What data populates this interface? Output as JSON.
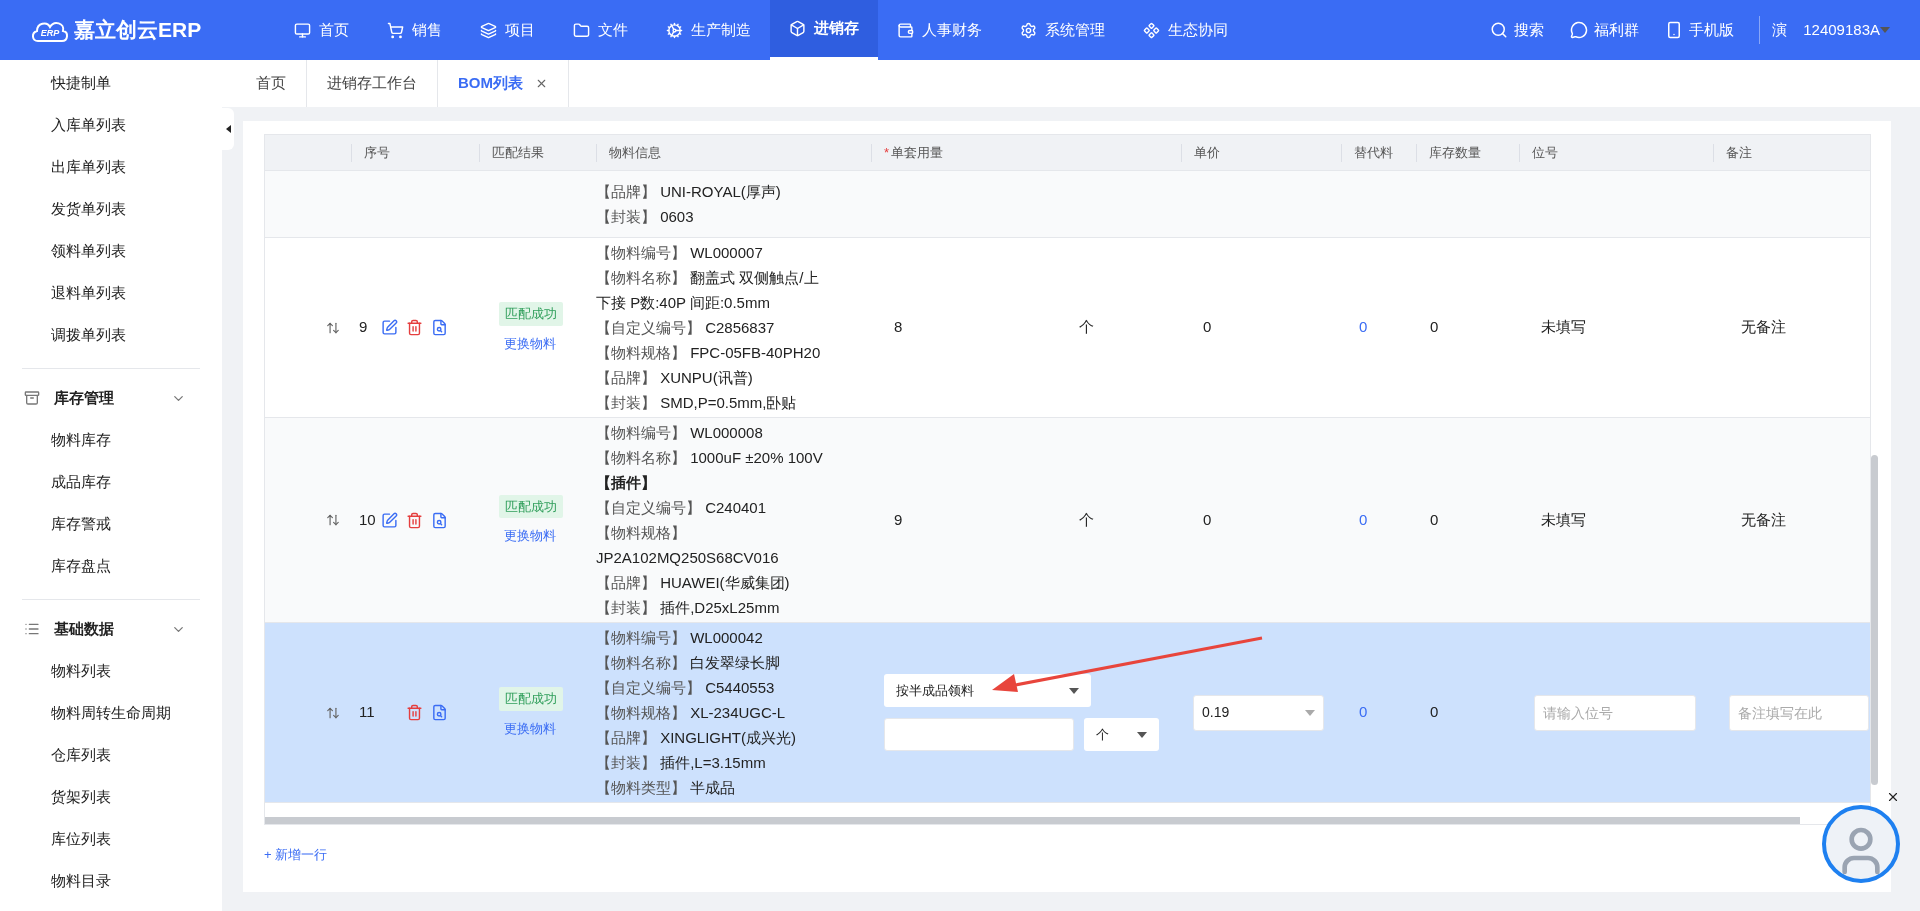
{
  "header": {
    "logo_badge": "ERP",
    "logo_text": "嘉立创云ERP",
    "nav": [
      {
        "label": "首页",
        "selected": false
      },
      {
        "label": "销售",
        "selected": false
      },
      {
        "label": "项目",
        "selected": false
      },
      {
        "label": "文件",
        "selected": false
      },
      {
        "label": "生产制造",
        "selected": false
      },
      {
        "label": "进销存",
        "selected": true
      },
      {
        "label": "人事财务",
        "selected": false
      },
      {
        "label": "系统管理",
        "selected": false
      },
      {
        "label": "生态协同",
        "selected": false
      }
    ],
    "actions": [
      {
        "label": "搜索"
      },
      {
        "label": "福利群"
      },
      {
        "label": "手机版"
      }
    ],
    "user": {
      "avatar": "演",
      "name": "12409183A"
    }
  },
  "sidebar": {
    "items": [
      {
        "label": "快捷制单"
      },
      {
        "label": "入库单列表"
      },
      {
        "label": "出库单列表"
      },
      {
        "label": "发货单列表"
      },
      {
        "label": "领料单列表"
      },
      {
        "label": "退料单列表"
      },
      {
        "label": "调拨单列表"
      }
    ],
    "groups": [
      {
        "label": "库存管理",
        "expanded": true,
        "items": [
          {
            "label": "物料库存"
          },
          {
            "label": "成品库存"
          },
          {
            "label": "库存警戒"
          },
          {
            "label": "库存盘点"
          }
        ]
      },
      {
        "label": "基础数据",
        "expanded": true,
        "items": [
          {
            "label": "物料列表"
          },
          {
            "label": "物料周转生命周期"
          },
          {
            "label": "仓库列表"
          },
          {
            "label": "货架列表"
          },
          {
            "label": "库位列表"
          },
          {
            "label": "物料目录"
          }
        ]
      }
    ]
  },
  "tabs": [
    {
      "label": "首页",
      "selected": false,
      "closable": false
    },
    {
      "label": "进销存工作台",
      "selected": false,
      "closable": false
    },
    {
      "label": "BOM列表",
      "selected": true,
      "closable": true
    }
  ],
  "table": {
    "columns": [
      {
        "label": "序号"
      },
      {
        "label": "匹配结果"
      },
      {
        "label": "物料信息"
      },
      {
        "label": "单套用量",
        "mark": "*"
      },
      {
        "label": "单价"
      },
      {
        "label": "替代料"
      },
      {
        "label": "库存数量"
      },
      {
        "label": "位号"
      },
      {
        "label": "备注"
      }
    ],
    "partial_row": {
      "info": [
        {
          "label": "【品牌】",
          "value": "UNI-ROYAL(厚声)"
        },
        {
          "label": "【封装】",
          "value": "0603"
        }
      ]
    },
    "rows": [
      {
        "kind": "static",
        "selected": false,
        "index": "9",
        "editable": true,
        "match": "匹配成功",
        "replace": "更换物料",
        "info": [
          {
            "label": "【物料编号】",
            "value": "WL000007"
          },
          {
            "label": "【物料名称】",
            "value": "翻盖式 双侧触点/上下接 P数:40P 间距:0.5mm"
          },
          {
            "label": "【自定义编号】",
            "value": "C2856837"
          },
          {
            "label": "【物料规格】",
            "value": "FPC-05FB-40PH20"
          },
          {
            "label": "【品牌】",
            "value": "XUNPU(讯普)"
          },
          {
            "label": "【封装】",
            "value": "SMD,P=0.5mm,卧贴"
          }
        ],
        "quantity": "8",
        "unit": "个",
        "price": "0",
        "substitute": "0",
        "stock": "0",
        "position": "未填写",
        "remark": "无备注"
      },
      {
        "kind": "static",
        "selected": false,
        "index": "10",
        "editable": true,
        "match": "匹配成功",
        "replace": "更换物料",
        "info": [
          {
            "label": "【物料编号】",
            "value": "WL000008"
          },
          {
            "label": "【物料名称】",
            "value": "1000uF ±20% 100V **【插件】**"
          },
          {
            "label": "【自定义编号】",
            "value": "C240401"
          },
          {
            "label": "【物料规格】",
            "value": "JP2A102MQ250S68CV016"
          },
          {
            "label": "【品牌】",
            "value": "HUAWEI(华威集团)"
          },
          {
            "label": "【封装】",
            "value": "插件,D25xL25mm"
          }
        ],
        "quantity": "9",
        "unit": "个",
        "price": "0",
        "substitute": "0",
        "stock": "0",
        "position": "未填写",
        "remark": "无备注"
      },
      {
        "kind": "editing",
        "selected": true,
        "index": "11",
        "editable": false,
        "match": "匹配成功",
        "replace": "更换物料",
        "info": [
          {
            "label": "【物料编号】",
            "value": "WL000042"
          },
          {
            "label": "【物料名称】",
            "value": "白发翠绿长脚"
          },
          {
            "label": "【自定义编号】",
            "value": "C5440553"
          },
          {
            "label": "【物料规格】",
            "value": "XL-234UGC-L"
          },
          {
            "label": "【品牌】",
            "value": "XINGLIGHT(成兴光)"
          },
          {
            "label": "【封装】",
            "value": "插件,L=3.15mm"
          },
          {
            "label": "【物料类型】",
            "value": "半成品"
          }
        ],
        "mode": "按半成品领料",
        "unit": "个",
        "price": "0.19",
        "substitute": "0",
        "stock": "0",
        "position_placeholder": "请输入位号",
        "remark_placeholder": "备注填写在此"
      }
    ]
  },
  "add_row": "+ 新增一行"
}
